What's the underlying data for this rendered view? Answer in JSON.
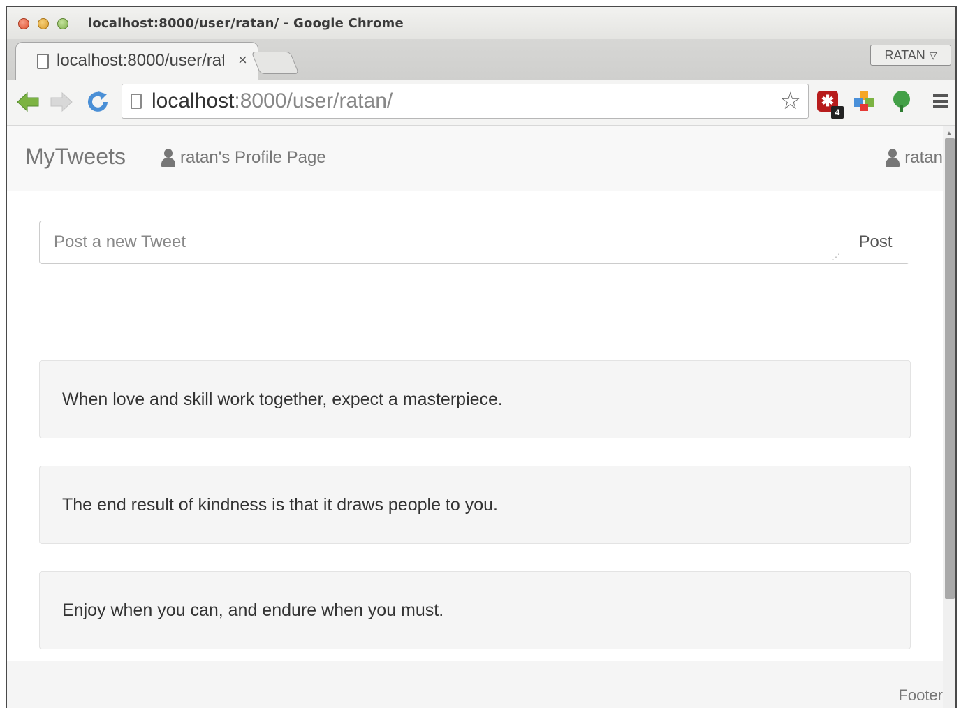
{
  "window": {
    "title": "localhost:8000/user/ratan/ - Google Chrome"
  },
  "tabs": [
    {
      "label": "localhost:8000/user/rat",
      "active": true
    }
  ],
  "profile_button": {
    "label": "RATAN"
  },
  "address_bar": {
    "host": "localhost",
    "rest": ":8000/user/ratan/"
  },
  "icons": {
    "back": "back-arrow-icon",
    "forward": "forward-arrow-icon",
    "reload": "reload-icon",
    "bookmark": "star-icon",
    "extensions": [
      "red-extension-icon",
      "puzzle-extension-icon",
      "evernote-icon"
    ],
    "menu": "hamburger-menu-icon"
  },
  "navbar": {
    "brand": "MyTweets",
    "profile_link": "ratan's Profile Page",
    "user": "ratan"
  },
  "post_form": {
    "placeholder": "Post a new Tweet",
    "submit_label": "Post"
  },
  "tweets": [
    {
      "text": "When love and skill work together, expect a masterpiece."
    },
    {
      "text": "The end result of kindness is that it draws people to you."
    },
    {
      "text": "Enjoy when you can, and endure when you must."
    }
  ],
  "footer": {
    "text": "Footer"
  },
  "colors": {
    "navbar_bg": "#f8f8f8",
    "tweet_bg": "#f5f5f5",
    "extension_red": "#b71c1c",
    "back_arrow_green": "#7cb342"
  }
}
